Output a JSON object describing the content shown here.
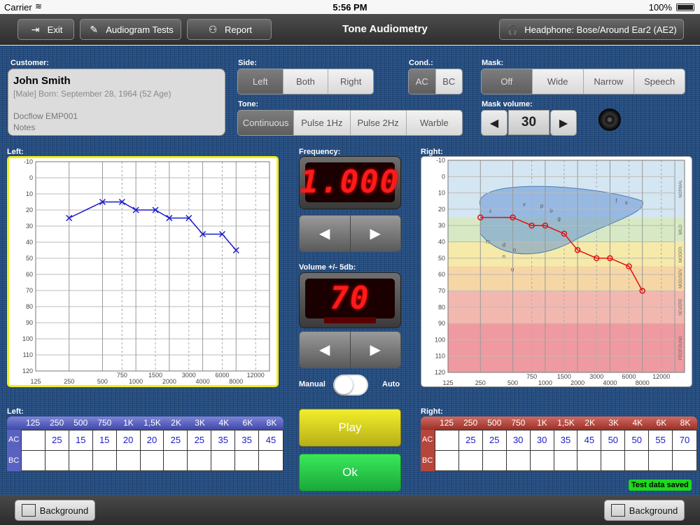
{
  "status_bar": {
    "carrier": "Carrier",
    "time": "5:56 PM",
    "battery": "100%"
  },
  "toolbar": {
    "exit_label": "Exit",
    "audiogram_tests_label": "Audiogram Tests",
    "report_label": "Report",
    "title": "Tone Audiometry",
    "headphone_label": "Headphone: Bose/Around Ear2 (AE2)"
  },
  "customer": {
    "label": "Customer:",
    "name": "John Smith",
    "info": "[Male] Born: September 28, 1964 (52 Age)",
    "id": "Docflow EMP001",
    "notes": "Notes"
  },
  "side": {
    "label": "Side:",
    "options": [
      "Left",
      "Both",
      "Right"
    ],
    "selected": "Left"
  },
  "cond": {
    "label": "Cond.:",
    "options": [
      "AC",
      "BC"
    ],
    "selected": "AC"
  },
  "mask": {
    "label": "Mask:",
    "options": [
      "Off",
      "Wide",
      "Narrow",
      "Speech"
    ],
    "selected": "Off"
  },
  "tone": {
    "label": "Tone:",
    "options": [
      "Continuous",
      "Pulse 1Hz",
      "Pulse 2Hz",
      "Warble"
    ],
    "selected": "Continuous"
  },
  "mask_volume": {
    "label": "Mask volume:",
    "value": "30",
    "decrease": "◀",
    "increase": "▶"
  },
  "frequency": {
    "label": "Frequency:",
    "display": "1.000",
    "prev": "◀",
    "next": "▶"
  },
  "volume": {
    "label": "Volume +/- 5db:",
    "display": "70",
    "prev": "◀",
    "next": "▶"
  },
  "mode": {
    "manual_label": "Manual",
    "auto_label": "Auto"
  },
  "play_label": "Play",
  "ok_label": "Ok",
  "saved_badge": "Test data saved",
  "background_label": "Background",
  "left_chart_label": "Left:",
  "right_chart_label": "Right:",
  "left_table_label": "Left:",
  "right_table_label": "Right:",
  "table_headers": [
    "125",
    "250",
    "500",
    "750",
    "1K",
    "1,5K",
    "2K",
    "3K",
    "4K",
    "6K",
    "8K"
  ],
  "row_labels": {
    "ac": "AC",
    "bc": "BC"
  },
  "left_table": {
    "ac": [
      "",
      "25",
      "15",
      "15",
      "20",
      "20",
      "25",
      "25",
      "35",
      "35",
      "45"
    ],
    "bc": [
      "",
      "",
      "",
      "",
      "",
      "",
      "",
      "",
      "",
      "",
      ""
    ]
  },
  "right_table": {
    "ac": [
      "",
      "25",
      "25",
      "30",
      "30",
      "35",
      "45",
      "50",
      "50",
      "55",
      "70"
    ],
    "bc": [
      "",
      "",
      "",
      "",
      "",
      "",
      "",
      "",
      "",
      "",
      ""
    ]
  },
  "chart_data": [
    {
      "type": "line",
      "title": "Left:",
      "x_ticks_top": [
        "750",
        "1500",
        "3000",
        "6000",
        "12000"
      ],
      "x_ticks_bottom": [
        "125",
        "250",
        "500",
        "1000",
        "2000",
        "4000",
        "8000"
      ],
      "y_ticks": [
        "-10",
        "0",
        "10",
        "20",
        "30",
        "40",
        "50",
        "60",
        "70",
        "80",
        "90",
        "100",
        "110",
        "120"
      ],
      "ylim": [
        -10,
        120
      ],
      "series": [
        {
          "color": "#1a1acc",
          "marker": "x",
          "x": [
            "250",
            "500",
            "750",
            "1000",
            "1500",
            "2000",
            "3000",
            "4000",
            "6000",
            "8000"
          ],
          "values": [
            25,
            15,
            15,
            20,
            20,
            25,
            25,
            35,
            35,
            45
          ]
        }
      ]
    },
    {
      "type": "line",
      "title": "Right:",
      "x_ticks_top": [
        "750",
        "1500",
        "3000",
        "6000",
        "12000"
      ],
      "x_ticks_bottom": [
        "125",
        "250",
        "500",
        "1000",
        "2000",
        "4000",
        "8000"
      ],
      "y_ticks": [
        "-10",
        "0",
        "10",
        "20",
        "30",
        "40",
        "50",
        "60",
        "70",
        "80",
        "90",
        "100",
        "110",
        "120"
      ],
      "ylim": [
        -10,
        120
      ],
      "bands": [
        {
          "name": "NORMAL",
          "from": -10,
          "to": 25,
          "color": "#d4e6f1"
        },
        {
          "name": "MILD",
          "from": 25,
          "to": 40,
          "color": "#d7e8c4"
        },
        {
          "name": "MODER.",
          "from": 40,
          "to": 55,
          "color": "#f5eaa8"
        },
        {
          "name": "MOD/SEV",
          "from": 55,
          "to": 70,
          "color": "#f6d6a4"
        },
        {
          "name": "SEVERE",
          "from": 70,
          "to": 90,
          "color": "#f2b8b0"
        },
        {
          "name": "PROFOUND",
          "from": 90,
          "to": 120,
          "color": "#ee9aa0"
        }
      ],
      "speech_letters": [
        "z",
        "v",
        "p",
        "f",
        "s",
        "m",
        "d",
        "b",
        "o",
        "g",
        "n",
        "u"
      ],
      "series": [
        {
          "color": "#e01010",
          "marker": "o",
          "x": [
            "250",
            "500",
            "750",
            "1000",
            "1500",
            "2000",
            "3000",
            "4000",
            "6000",
            "8000"
          ],
          "values": [
            25,
            25,
            30,
            30,
            35,
            45,
            50,
            50,
            55,
            70
          ]
        }
      ]
    }
  ]
}
